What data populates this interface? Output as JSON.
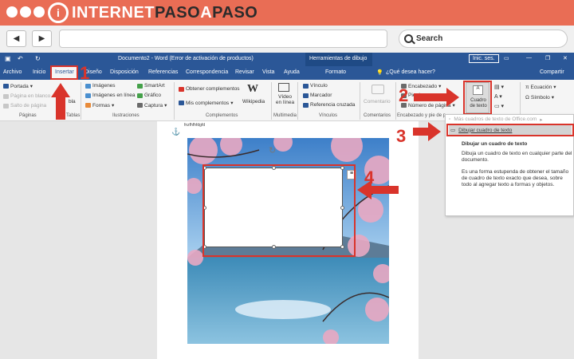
{
  "site": {
    "logo_letter": "i",
    "logo_part1": "INTERNET",
    "logo_part2": "PASO",
    "logo_part3": "A",
    "logo_part4": "PASO",
    "search_label": "Search"
  },
  "word": {
    "doc_title": "Documento2 - Word (Error de activación de productos)",
    "contextual": "Herramientas de dibujo",
    "signin": "Inic. ses.",
    "tabs": [
      "Archivo",
      "Inicio",
      "Insertar",
      "Diseño",
      "Disposición",
      "Referencias",
      "Correspondencia",
      "Revisar",
      "Vista",
      "Ayuda",
      "Formato"
    ],
    "tell_me": "¿Qué desea hacer?",
    "share": "Compartir",
    "ribbon": {
      "pages": [
        "Portada",
        "Página en blanco",
        "Salto de página"
      ],
      "tables_frag": "bla",
      "tables_group": "Tablas",
      "illustrations": [
        "Imágenes",
        "Imágenes en línea",
        "Formas",
        "SmartArt",
        "Gráfico",
        "Captura"
      ],
      "addins": [
        "Obtener complementos",
        "Mis complementos"
      ],
      "wikipedia": "Wikipedia",
      "media": "Vídeo en línea",
      "links": [
        "Vínculo",
        "Marcador",
        "Referencia cruzada"
      ],
      "comment": "Comentario",
      "header_footer": [
        "Encabezado",
        "Pie de p",
        "Número de página"
      ],
      "textbox_btn": "Cuadro de texto",
      "symbols": [
        "Ecuación",
        "Símbolo"
      ],
      "groups": [
        "Páginas",
        "Ilustraciones",
        "Complementos",
        "Multimedia",
        "Vínculos",
        "Comentarios",
        "Encabezado y pie de p"
      ]
    },
    "doc_snippet": "fnzfhfhfdgfd",
    "dropdown": {
      "item1": "Más cuadros de texto de Office.com",
      "item2": "Dibujar cuadro de texto",
      "tip_title": "Dibujar un cuadro de texto",
      "tip_body1": "Dibuja un cuadro de texto en cualquier parte del documento.",
      "tip_body2": "Es una forma estupenda de obtener el tamaño de cuadro de texto exacto que desea, sobre todo al agregar texto a formas y objetos."
    }
  },
  "annotations": [
    "1",
    "2",
    "3",
    "4"
  ],
  "colors": {
    "accent": "#e96d55",
    "word_blue": "#2b5797",
    "annotation_red": "#d9342b"
  }
}
